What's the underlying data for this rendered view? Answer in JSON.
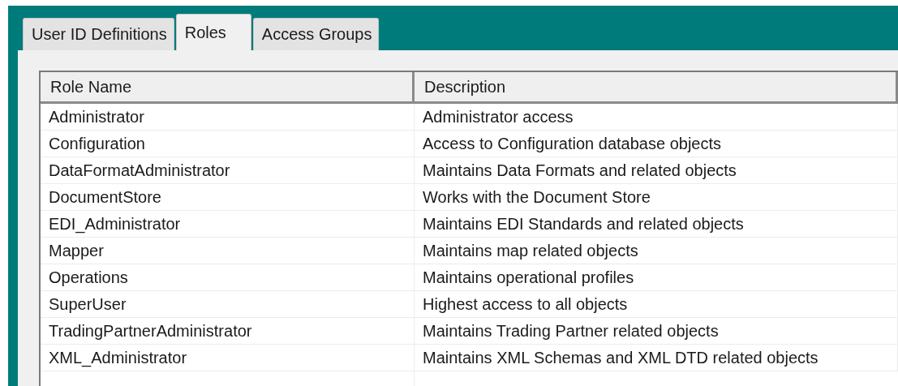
{
  "tabs": [
    {
      "label": "User ID Definitions",
      "selected": false
    },
    {
      "label": "Roles",
      "selected": true
    },
    {
      "label": "Access Groups",
      "selected": false
    }
  ],
  "table": {
    "columns": [
      "Role Name",
      "Description"
    ],
    "rows": [
      [
        "Administrator",
        "Administrator access"
      ],
      [
        "Configuration",
        "Access to Configuration database objects"
      ],
      [
        "DataFormatAdministrator",
        "Maintains Data Formats and related objects"
      ],
      [
        "DocumentStore",
        "Works with the Document Store"
      ],
      [
        "EDI_Administrator",
        "Maintains EDI Standards and related objects"
      ],
      [
        "Mapper",
        "Maintains map related objects"
      ],
      [
        "Operations",
        "Maintains operational profiles"
      ],
      [
        "SuperUser",
        "Highest access to all objects"
      ],
      [
        "TradingPartnerAdministrator",
        "Maintains Trading Partner related objects"
      ],
      [
        "XML_Administrator",
        "Maintains XML Schemas and XML DTD related objects"
      ]
    ]
  }
}
